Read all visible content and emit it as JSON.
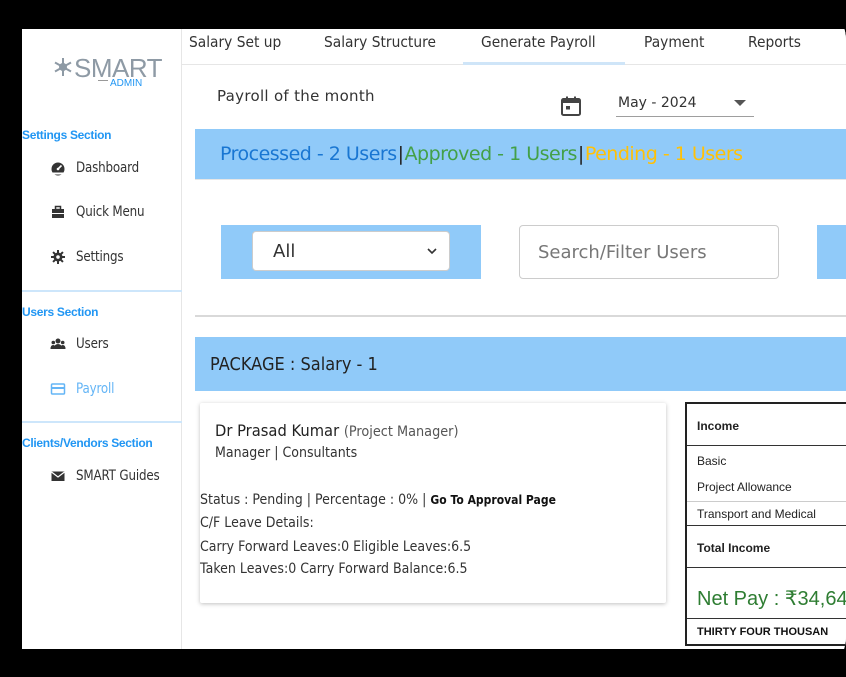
{
  "app": {
    "logo_text": "SMART",
    "logo_sub": "ADMIN"
  },
  "tabs": [
    "Salary Set up",
    "Salary Structure",
    "Generate Payroll",
    "Payment",
    "Reports"
  ],
  "sidebar": {
    "settings_title": "Settings Section",
    "settings_items": [
      {
        "label": "Dashboard",
        "icon": "dashboard-icon"
      },
      {
        "label": "Quick Menu",
        "icon": "briefcase-icon"
      },
      {
        "label": "Settings",
        "icon": "gear-icon"
      }
    ],
    "users_title": "Users Section",
    "users_items": [
      {
        "label": "Users",
        "icon": "users-icon"
      },
      {
        "label": "Payroll",
        "icon": "payroll-icon"
      }
    ],
    "clients_title": "Clients/Vendors Section",
    "clients_items": [
      {
        "label": "SMART Guides",
        "icon": "envelope-icon"
      }
    ]
  },
  "main": {
    "month_label": "Payroll of the month",
    "month_value": "May - 2024",
    "status": {
      "processed": "Processed - 2 Users",
      "approved": "Approved - 1 Users",
      "pending": "Pending - 1 Users",
      "separator": "|"
    },
    "filter": {
      "selected": "All",
      "search_placeholder": "Search/Filter Users"
    },
    "package_label": "PACKAGE : Salary - 1"
  },
  "user_card": {
    "name": "Dr Prasad Kumar",
    "role": "(Project Manager)",
    "dept": "Manager | Consultants",
    "status_line": "Status : Pending | Percentage : 0% |",
    "approval_link": "Go To Approval Page",
    "cf_title": "C/F Leave Details:",
    "leaves_line1": "Carry Forward Leaves:0   Eligible Leaves:6.5",
    "leaves_line2": "Taken Leaves:0   Carry Forward Balance:6.5"
  },
  "salary_table": {
    "income_header": "Income",
    "rows": [
      "Basic",
      "Project Allowance",
      "Transport and Medical"
    ],
    "total_label": "Total Income",
    "net_pay": "Net Pay : ₹34,64",
    "words": "THIRTY FOUR THOUSAN"
  },
  "colors": {
    "accent_blue": "#90caf9",
    "processed": "#1976d2",
    "approved": "#43a047",
    "pending": "#ffc107",
    "section_title": "#2196f3",
    "net_pay": "#2e7d32"
  }
}
